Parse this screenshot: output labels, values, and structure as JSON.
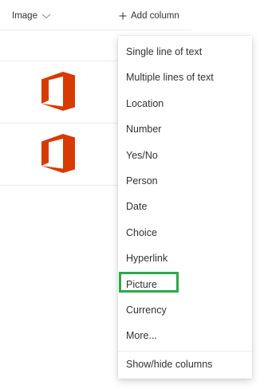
{
  "header": {
    "image_column_label": "Image",
    "add_column_label": "Add column"
  },
  "rows": [
    {
      "image_icon": "office-logo-icon"
    },
    {
      "image_icon": "office-logo-icon"
    }
  ],
  "menu": {
    "items": [
      {
        "label": "Single line of text"
      },
      {
        "label": "Multiple lines of text"
      },
      {
        "label": "Location"
      },
      {
        "label": "Number"
      },
      {
        "label": "Yes/No"
      },
      {
        "label": "Person"
      },
      {
        "label": "Date"
      },
      {
        "label": "Choice"
      },
      {
        "label": "Hyperlink"
      },
      {
        "label": "Picture"
      },
      {
        "label": "Currency"
      },
      {
        "label": "More..."
      }
    ],
    "footer_label": "Show/hide columns",
    "highlighted_item": "Picture"
  },
  "colors": {
    "office_orange": "#d83b01",
    "highlight_green": "#2ea84a",
    "text": "#323130",
    "divider": "#edebe9"
  }
}
